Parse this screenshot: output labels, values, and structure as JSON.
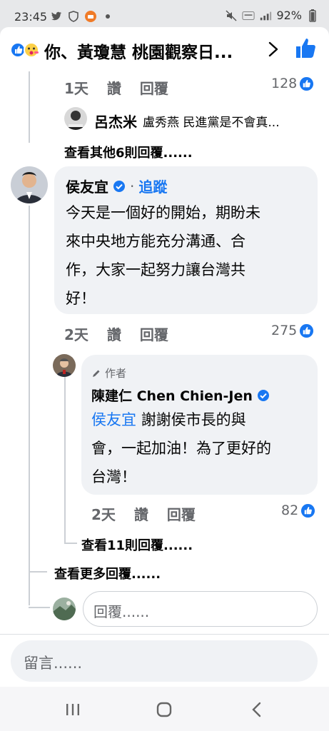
{
  "status": {
    "time": "23:45",
    "battery": "92%"
  },
  "header": {
    "title": "你、黃瓊慧 桃園觀察日..."
  },
  "threads": {
    "prev_reply": {
      "time": "1天",
      "like": "讚",
      "reply": "回覆",
      "count": "128"
    },
    "prev_preview": {
      "name": "呂杰米",
      "text": "盧秀燕 民進黨是不會真..."
    },
    "view_other": "查看其他6則回覆......"
  },
  "comment_main": {
    "author": "侯友宜",
    "follow": "追蹤",
    "text_lines": [
      "今天是一個好的開始，期盼未",
      "來中央地方能充分溝通、合",
      "作，大家一起努力讓台灣共",
      "好！"
    ],
    "time": "2天",
    "like": "讚",
    "reply": "回覆",
    "count": "275"
  },
  "reply_author": {
    "badge": "作者",
    "name": "陳建仁 Chen Chien-Jen",
    "mention": "侯友宜",
    "text_line1": "謝謝侯市長的與",
    "text_line2": "會，一起加油！為了更好的",
    "text_line3": "台灣！",
    "time": "2天",
    "like": "讚",
    "reply": "回覆",
    "count": "82"
  },
  "view_11": "查看11則回覆......",
  "view_more": "查看更多回覆......",
  "reply_placeholder": "回覆......",
  "comment_placeholder": "留言......",
  "colors": {
    "accent": "#1877f2",
    "bubble": "#f0f2f5",
    "meta": "#65676b"
  }
}
